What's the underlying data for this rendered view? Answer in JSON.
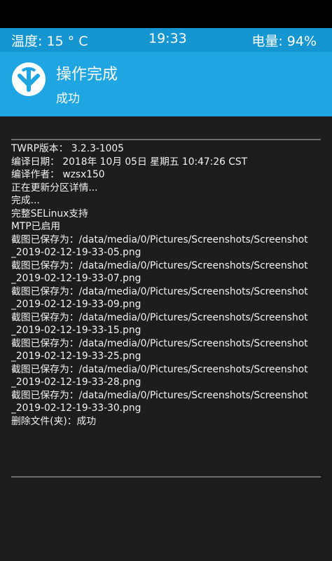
{
  "status_bar": {
    "temperature": "温度: 15 ° C",
    "time": "19:33",
    "battery": "电量: 94%"
  },
  "header": {
    "logo_icon": "twrp-logo-icon",
    "title": "操作完成",
    "subtitle": "成功"
  },
  "console": {
    "lines": [
      "TWRP版本：  3.2.3-1005",
      "编译日期：  2018年 10月 05日 星期五 10:47:26 CST",
      "编译作者：  wzsx150",
      "正在更新分区详情...",
      "完成...",
      "完整SELinux支持",
      "MTP已启用",
      "截图已保存为：/data/media/0/Pictures/Screenshots/Screenshot",
      "_2019-02-12-19-33-05.png",
      "截图已保存为：/data/media/0/Pictures/Screenshots/Screenshot",
      "_2019-02-12-19-33-07.png",
      "截图已保存为：/data/media/0/Pictures/Screenshots/Screenshot",
      "_2019-02-12-19-33-09.png",
      "截图已保存为：/data/media/0/Pictures/Screenshots/Screenshot",
      "_2019-02-12-19-33-15.png",
      "截图已保存为：/data/media/0/Pictures/Screenshots/Screenshot",
      "_2019-02-12-19-33-25.png",
      "截图已保存为：/data/media/0/Pictures/Screenshots/Screenshot",
      "_2019-02-12-19-33-28.png",
      "截图已保存为：/data/media/0/Pictures/Screenshots/Screenshot",
      "_2019-02-12-19-33-30.png",
      "删除文件(夹)：成功"
    ]
  },
  "colors": {
    "status_bar_bg": "#1596d1",
    "header_bg": "#1ea5e2",
    "console_bg": "#1d1d1d",
    "text": "#f1f1f1"
  }
}
